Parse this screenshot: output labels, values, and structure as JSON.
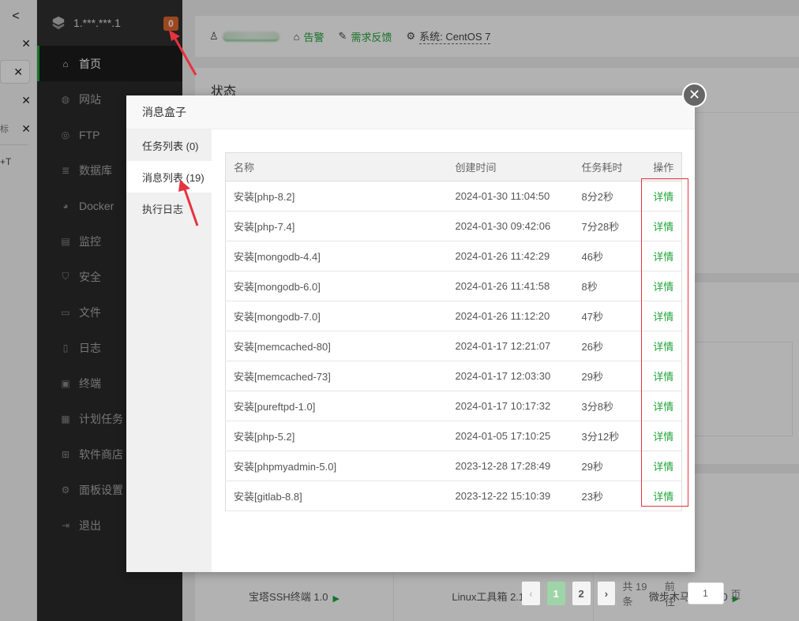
{
  "edge": {
    "back": "<",
    "close": "✕",
    "side_label": "标",
    "shortcut": "+T"
  },
  "sidebar": {
    "ip": "1.***.***.1",
    "badge": "0",
    "items": [
      {
        "label": "首页",
        "icon": "home-icon"
      },
      {
        "label": "网站",
        "icon": "globe-icon"
      },
      {
        "label": "FTP",
        "icon": "ftp-icon"
      },
      {
        "label": "数据库",
        "icon": "database-icon"
      },
      {
        "label": "Docker",
        "icon": "docker-icon"
      },
      {
        "label": "监控",
        "icon": "monitor-icon"
      },
      {
        "label": "安全",
        "icon": "shield-icon"
      },
      {
        "label": "文件",
        "icon": "folder-icon"
      },
      {
        "label": "日志",
        "icon": "log-icon"
      },
      {
        "label": "终端",
        "icon": "terminal-icon"
      },
      {
        "label": "计划任务",
        "icon": "calendar-icon"
      },
      {
        "label": "软件商店",
        "icon": "apps-icon"
      },
      {
        "label": "面板设置",
        "icon": "gear-icon"
      },
      {
        "label": "退出",
        "icon": "logout-icon"
      }
    ]
  },
  "topbar": {
    "alert": "告警",
    "feedback": "需求反馈",
    "system": "系统: CentOS 7"
  },
  "main": {
    "status_title": "状态",
    "softs": [
      "宝塔SSH终端 1.0",
      "Linux工具箱 2.1",
      "微步木马检测 1.0"
    ]
  },
  "modal": {
    "title": "消息盒子",
    "tabs": [
      "任务列表 (0)",
      "消息列表 (19)",
      "执行日志"
    ],
    "table": {
      "headers": [
        "名称",
        "创建时间",
        "任务耗时",
        "操作"
      ],
      "action_label": "详情",
      "rows": [
        {
          "name": "安装[php-8.2]",
          "time": "2024-01-30 11:04:50",
          "duration": "8分2秒"
        },
        {
          "name": "安装[php-7.4]",
          "time": "2024-01-30 09:42:06",
          "duration": "7分28秒"
        },
        {
          "name": "安装[mongodb-4.4]",
          "time": "2024-01-26 11:42:29",
          "duration": "46秒"
        },
        {
          "name": "安装[mongodb-6.0]",
          "time": "2024-01-26 11:41:58",
          "duration": "8秒"
        },
        {
          "name": "安装[mongodb-7.0]",
          "time": "2024-01-26 11:12:20",
          "duration": "47秒"
        },
        {
          "name": "安装[memcached-80]",
          "time": "2024-01-17 12:21:07",
          "duration": "26秒"
        },
        {
          "name": "安装[memcached-73]",
          "time": "2024-01-17 12:03:30",
          "duration": "29秒"
        },
        {
          "name": "安装[pureftpd-1.0]",
          "time": "2024-01-17 10:17:32",
          "duration": "3分8秒"
        },
        {
          "name": "安装[php-5.2]",
          "time": "2024-01-05 17:10:25",
          "duration": "3分12秒"
        },
        {
          "name": "安装[phpmyadmin-5.0]",
          "time": "2023-12-28 17:28:49",
          "duration": "29秒"
        },
        {
          "name": "安装[gitlab-8.8]",
          "time": "2023-12-22 15:10:39",
          "duration": "23秒"
        }
      ]
    },
    "pager": {
      "prev": "‹",
      "pages": [
        "1",
        "2"
      ],
      "next": "›",
      "total": "共 19 条",
      "goto_prefix": "前往",
      "goto_value": "1",
      "goto_suffix": "页"
    }
  },
  "colors": {
    "accent": "#20a53a",
    "badge": "#e0662d",
    "annotation": "#e6333d"
  }
}
